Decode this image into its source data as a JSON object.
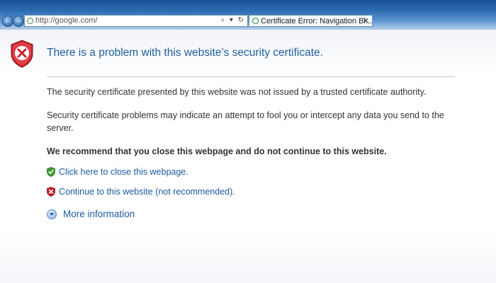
{
  "browser": {
    "address": "http://google.com/",
    "address_tools": "⌕ ▾ ↻",
    "tab_title": "Certificate Error: Navigation Bl...",
    "tab_close": "✕",
    "back_glyph": "←",
    "forward_glyph": "→"
  },
  "page": {
    "heading": "There is a problem with this website’s security certificate.",
    "para1": "The security certificate presented by this website was not issued by a trusted certificate authority.",
    "para2": "Security certificate problems may indicate an attempt to fool you or intercept any data you send to the server.",
    "recommend": "We recommend that you close this webpage and do not continue to this website.",
    "close_link": "Click here to close this webpage.",
    "continue_link": "Continue to this website (not recommended).",
    "more_info": "More information"
  },
  "colors": {
    "heading": "#1f5f9e",
    "link": "#1c5aa0",
    "shield_red": "#c8232c",
    "shield_green": "#3f9b35"
  }
}
